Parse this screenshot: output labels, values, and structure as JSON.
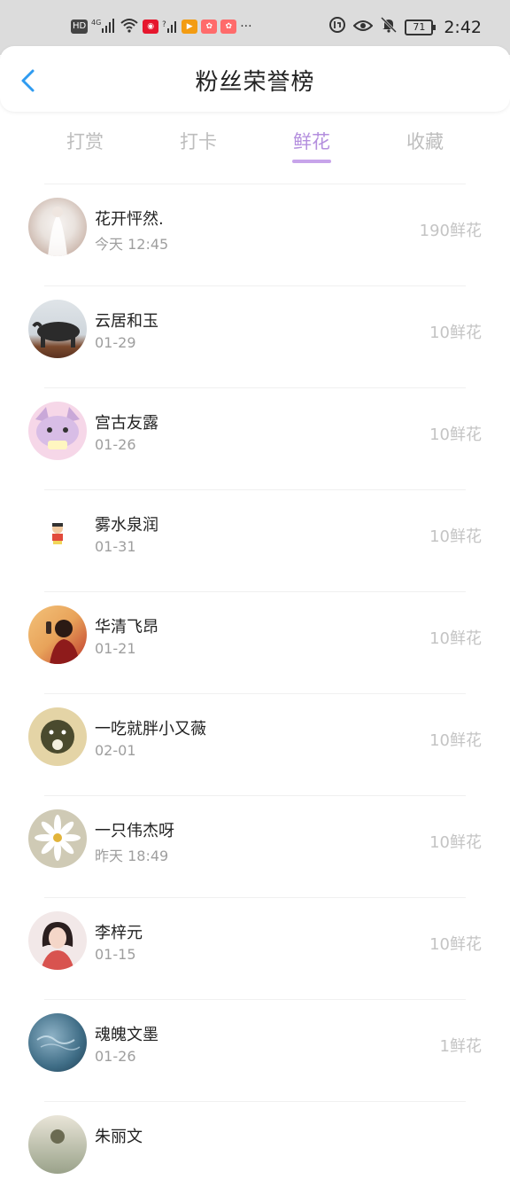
{
  "status_bar": {
    "left_labels": [
      "HD",
      "4G"
    ],
    "battery": "71",
    "time": "2:42",
    "more": "···"
  },
  "header": {
    "title": "粉丝荣誉榜"
  },
  "tabs": [
    {
      "label": "打赏",
      "active": false
    },
    {
      "label": "打卡",
      "active": false
    },
    {
      "label": "鲜花",
      "active": true
    },
    {
      "label": "收藏",
      "active": false
    }
  ],
  "fans": [
    {
      "name": "花开怦然.",
      "date": "今天 12:45",
      "count": "190鲜花"
    },
    {
      "name": "云居和玉",
      "date": "01-29",
      "count": "10鲜花"
    },
    {
      "name": "宫古友露",
      "date": "01-26",
      "count": "10鲜花"
    },
    {
      "name": "雾水泉润",
      "date": "01-31",
      "count": "10鲜花"
    },
    {
      "name": "华清飞昂",
      "date": "01-21",
      "count": "10鲜花"
    },
    {
      "name": "一吃就胖小又薇",
      "date": "02-01",
      "count": "10鲜花"
    },
    {
      "name": "一只伟杰呀",
      "date": "昨天 18:49",
      "count": "10鲜花"
    },
    {
      "name": "李梓元",
      "date": "01-15",
      "count": "10鲜花"
    },
    {
      "name": "魂魄文墨",
      "date": "01-26",
      "count": "1鲜花"
    },
    {
      "name": "朱丽文",
      "date": "",
      "count": ""
    }
  ],
  "colors": {
    "accent": "#b48fde",
    "back_arrow": "#2f9bf0",
    "muted": "#c4c4c4"
  }
}
